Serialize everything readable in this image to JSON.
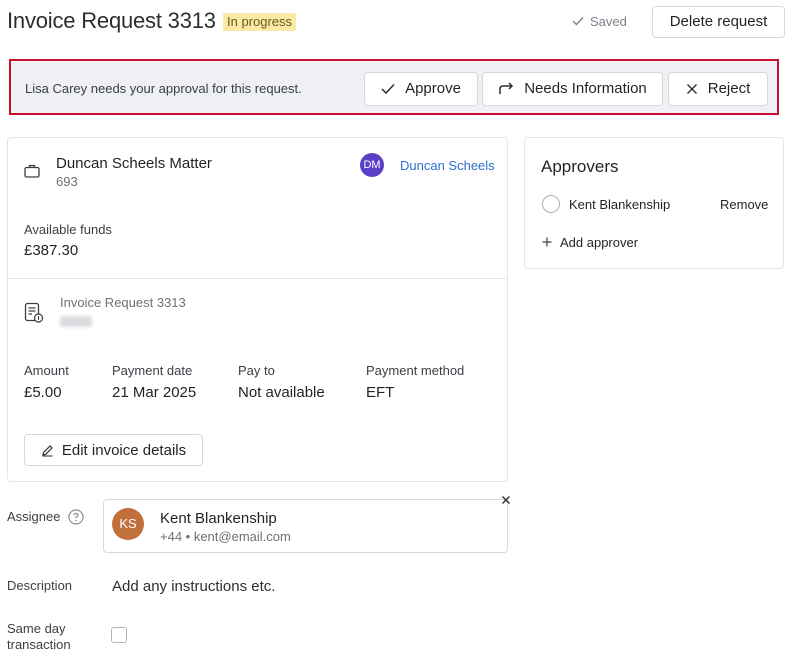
{
  "header": {
    "title": "Invoice Request 3313",
    "status_badge": "In progress",
    "saved_label": "Saved",
    "delete_label": "Delete request"
  },
  "approval_banner": {
    "message": "Lisa Carey needs your approval for this request.",
    "approve_label": "Approve",
    "needs_info_label": "Needs Information",
    "reject_label": "Reject"
  },
  "matter": {
    "name": "Duncan Scheels Matter",
    "number": "693",
    "person_initials": "DM",
    "person_name": "Duncan Scheels",
    "funds_label": "Available funds",
    "funds_value": "£387.30"
  },
  "invoice": {
    "title": "Invoice Request 3313",
    "fields": [
      {
        "label": "Amount",
        "value": "£5.00"
      },
      {
        "label": "Payment date",
        "value": "21 Mar 2025"
      },
      {
        "label": "Pay to",
        "value": "Not available"
      },
      {
        "label": "Payment method",
        "value": "EFT"
      }
    ],
    "edit_label": "Edit invoice details"
  },
  "approvers": {
    "title": "Approvers",
    "items": [
      {
        "name": "Kent Blankenship",
        "remove_label": "Remove"
      }
    ],
    "add_label": "Add approver"
  },
  "assignee": {
    "label": "Assignee",
    "initials": "KS",
    "name": "Kent Blankenship",
    "contact": "+44 • kent@email.com"
  },
  "description": {
    "label": "Description",
    "value": "Add any instructions etc."
  },
  "same_day": {
    "label_line1": "Same day",
    "label_line2": "transaction",
    "checked": false
  },
  "colors": {
    "accent_link": "#2f6fd1",
    "banner_border": "#c8102e",
    "badge_bg": "#fbeaa5",
    "avatar_dm": "#5b3fc4",
    "avatar_ks": "#c0703a"
  }
}
